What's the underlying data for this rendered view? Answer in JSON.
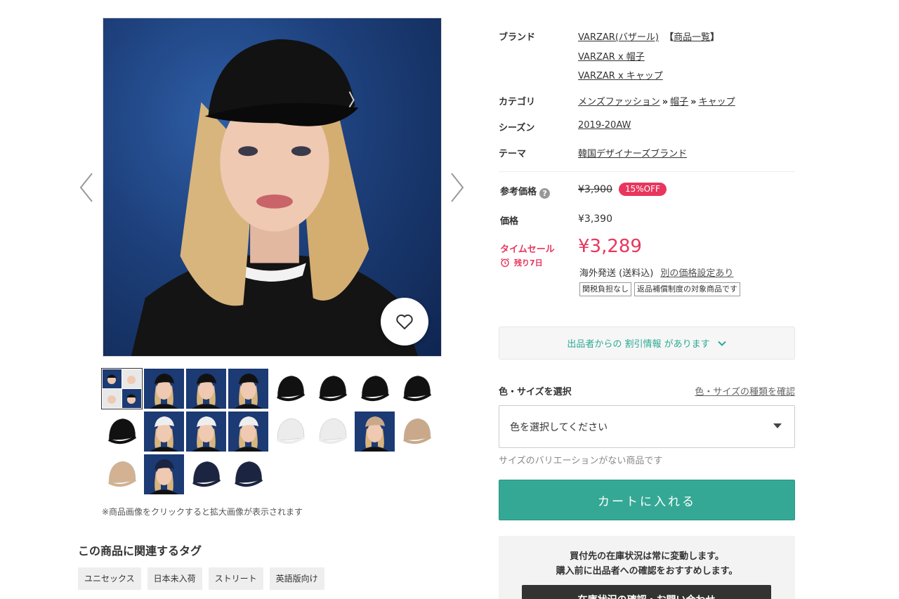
{
  "gallery": {
    "note": "※商品画像をクリックすると拡大画像が表示されます",
    "thumbnails": [
      {
        "kind": "collage",
        "bg": "#1c3a73"
      },
      {
        "kind": "model",
        "bg": "#1c3a73",
        "cap": "#111111"
      },
      {
        "kind": "model",
        "bg": "#1c3a73",
        "cap": "#111111"
      },
      {
        "kind": "model",
        "bg": "#1c3a73",
        "cap": "#111111"
      },
      {
        "kind": "cap",
        "bg": "#ffffff",
        "cap": "#111111"
      },
      {
        "kind": "cap",
        "bg": "#ffffff",
        "cap": "#111111"
      },
      {
        "kind": "cap",
        "bg": "#ffffff",
        "cap": "#111111"
      },
      {
        "kind": "cap",
        "bg": "#ffffff",
        "cap": "#111111"
      },
      {
        "kind": "cap",
        "bg": "#ffffff",
        "cap": "#111111"
      },
      {
        "kind": "model",
        "bg": "#1c3a73",
        "cap": "#eeeeee"
      },
      {
        "kind": "model",
        "bg": "#1c3a73",
        "cap": "#eeeeee"
      },
      {
        "kind": "model",
        "bg": "#1c3a73",
        "cap": "#eeeeee"
      },
      {
        "kind": "cap",
        "bg": "#ffffff",
        "cap": "#ececec"
      },
      {
        "kind": "cap",
        "bg": "#ffffff",
        "cap": "#ececec"
      },
      {
        "kind": "model",
        "bg": "#1c3a73",
        "cap": "#c9a98a"
      },
      {
        "kind": "cap",
        "bg": "#ffffff",
        "cap": "#c9a98a"
      },
      {
        "kind": "cap",
        "bg": "#ffffff",
        "cap": "#d2b292"
      },
      {
        "kind": "model",
        "bg": "#1c3a73",
        "cap": "#1b2440"
      },
      {
        "kind": "cap",
        "bg": "#ffffff",
        "cap": "#1b2440"
      },
      {
        "kind": "cap",
        "bg": "#ffffff",
        "cap": "#1b2440"
      }
    ]
  },
  "tags": {
    "title": "この商品に関連するタグ",
    "items": [
      "ユニセックス",
      "日本未入荷",
      "ストリート",
      "英語版向け"
    ]
  },
  "specs": {
    "brand_label": "ブランド",
    "brand_name": "VARZAR(バザール)",
    "brand_list_open": "【",
    "brand_list": "商品一覧",
    "brand_list_close": "】",
    "brand_link2": "VARZAR x 帽子",
    "brand_link3": "VARZAR x キャップ",
    "category_label": "カテゴリ",
    "category_path": [
      "メンズファッション",
      "帽子",
      "キャップ"
    ],
    "category_sep": "»",
    "season_label": "シーズン",
    "season": "2019-20AW",
    "theme_label": "テーマ",
    "theme": "韓国デザイナーズブランド"
  },
  "price": {
    "ref_label": "参考価格",
    "help_icon": "?",
    "ref_price": "¥3,900",
    "off_badge": "15%OFF",
    "price_label": "価格",
    "price": "¥3,390",
    "sale_label": "タイムセール",
    "remaining": "残り7日",
    "sale_price": "¥3,289",
    "shipping": "海外発送 (送料込)",
    "alt_price_link": "別の価格設定あり",
    "badges": [
      "関税負担なし",
      "返品補償制度の対象商品です"
    ]
  },
  "discount_info": "出品者からの 割引情報 があります",
  "variant": {
    "label": "色・サイズを選択",
    "check_link": "色・サイズの種類を確認",
    "placeholder": "色を選択してください",
    "no_size": "サイズのバリエーションがない商品です"
  },
  "cart_label": "カートに入れる",
  "stock": {
    "line1": "買付先の在庫状況は常に変動します。",
    "line2": "購入前に出品者への確認をおすすめします。",
    "button": "在庫状況の確認・お問い合わせ"
  },
  "colors": {
    "accent": "#34a895",
    "sale": "#e8365d",
    "photo_bg": "#1d3f7a"
  }
}
